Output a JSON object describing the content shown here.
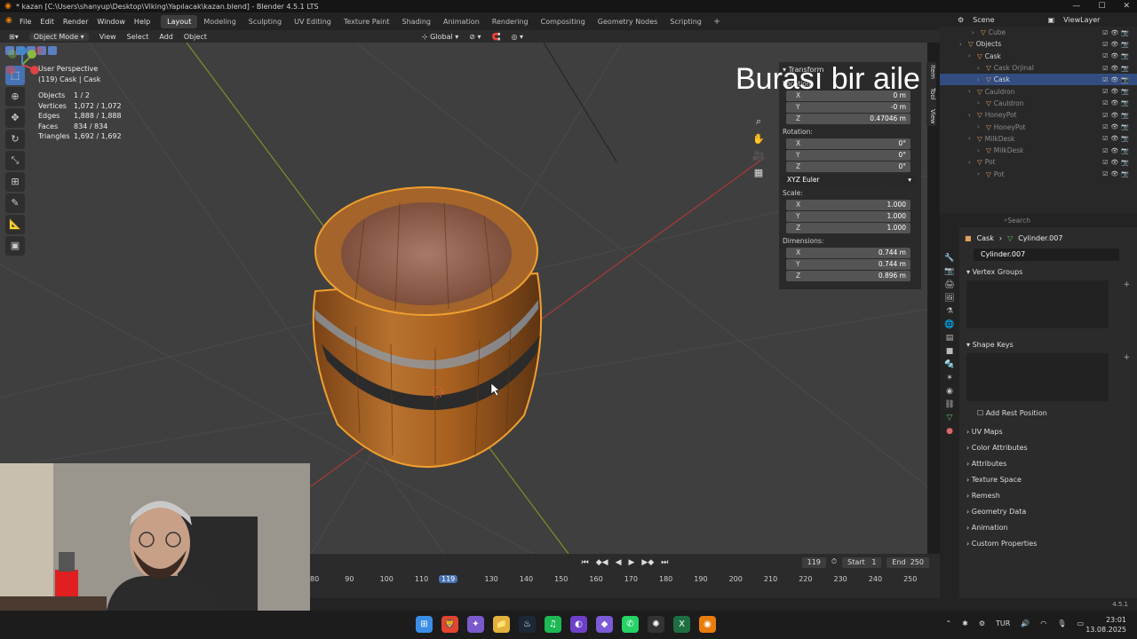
{
  "window": {
    "title": "* kazan [C:\\Users\\shanyup\\Desktop\\Viking\\Yapılacak\\kazan.blend] - Blender 4.5.1 LTS",
    "min": "—",
    "max": "☐",
    "close": "✕"
  },
  "menu": [
    "File",
    "Edit",
    "Render",
    "Window",
    "Help"
  ],
  "workspaces": [
    "Layout",
    "Modeling",
    "Sculpting",
    "UV Editing",
    "Texture Paint",
    "Shading",
    "Animation",
    "Rendering",
    "Compositing",
    "Geometry Nodes",
    "Scripting"
  ],
  "workspace_add": "+",
  "viewport_header": {
    "mode": "Object Mode",
    "items": [
      "View",
      "Select",
      "Add",
      "Object"
    ],
    "orientation": "Global"
  },
  "overlay_stats": {
    "view": "User Perspective",
    "sub": "(119) Cask | Cask",
    "rows": [
      {
        "k": "Objects",
        "v": "1 / 2"
      },
      {
        "k": "Vertices",
        "v": "1,072 / 1,072"
      },
      {
        "k": "Edges",
        "v": "1,888 / 1,888"
      },
      {
        "k": "Faces",
        "v": "834 / 834"
      },
      {
        "k": "Triangles",
        "v": "1,692 / 1,692"
      }
    ]
  },
  "subtitle": "Burası bir aile müessesesi.",
  "npanel": {
    "header": "Transform",
    "location_label": "Location:",
    "location": [
      {
        "ax": "X",
        "v": "0 m"
      },
      {
        "ax": "Y",
        "v": "-0 m"
      },
      {
        "ax": "Z",
        "v": "0.47046 m"
      }
    ],
    "rotation_label": "Rotation:",
    "rotation": [
      {
        "ax": "X",
        "v": "0°"
      },
      {
        "ax": "Y",
        "v": "0°"
      },
      {
        "ax": "Z",
        "v": "0°"
      }
    ],
    "rotation_mode": "XYZ Euler",
    "scale_label": "Scale:",
    "scale": [
      {
        "ax": "X",
        "v": "1.000"
      },
      {
        "ax": "Y",
        "v": "1.000"
      },
      {
        "ax": "Z",
        "v": "1.000"
      }
    ],
    "dimensions_label": "Dimensions:",
    "dimensions": [
      {
        "ax": "X",
        "v": "0.744 m"
      },
      {
        "ax": "Y",
        "v": "0.744 m"
      },
      {
        "ax": "Z",
        "v": "0.896 m"
      }
    ],
    "tabs": [
      "Item",
      "Tool",
      "View"
    ]
  },
  "outliner": {
    "scene": "Scene",
    "view_layer": "ViewLayer",
    "rows": [
      {
        "label": "Cube",
        "indent": 36,
        "cls": "dim"
      },
      {
        "label": "Objects",
        "indent": 22,
        "cls": ""
      },
      {
        "label": "Cask",
        "indent": 32,
        "cls": ""
      },
      {
        "label": "Cask Orjinal",
        "indent": 42,
        "cls": "dim"
      },
      {
        "label": "Cask",
        "indent": 42,
        "cls": "sel"
      },
      {
        "label": "Cauldron",
        "indent": 32,
        "cls": "dim"
      },
      {
        "label": "Cauldron",
        "indent": 42,
        "cls": "dim"
      },
      {
        "label": "HoneyPot",
        "indent": 32,
        "cls": "dim"
      },
      {
        "label": "HoneyPot",
        "indent": 42,
        "cls": "dim"
      },
      {
        "label": "MilkDesk",
        "indent": 32,
        "cls": "dim"
      },
      {
        "label": "MilkDesk",
        "indent": 42,
        "cls": "dim"
      },
      {
        "label": "Pot",
        "indent": 32,
        "cls": "dim"
      },
      {
        "label": "Pot",
        "indent": 42,
        "cls": "dim"
      }
    ]
  },
  "properties": {
    "search_placeholder": "Search",
    "object": "Cask",
    "mesh": "Cylinder.007",
    "sections": {
      "vertex_groups": "Vertex Groups",
      "shape_keys": "Shape Keys",
      "add_rest": "Add Rest Position",
      "rest": [
        "UV Maps",
        "Color Attributes",
        "Attributes",
        "Texture Space",
        "Remesh",
        "Geometry Data",
        "Animation",
        "Custom Properties"
      ]
    }
  },
  "timeline": {
    "current": "119",
    "start_label": "Start",
    "start": "1",
    "end_label": "End",
    "end": "250",
    "ticks": [
      "80",
      "90",
      "100",
      "110",
      "130",
      "140",
      "150",
      "160",
      "170",
      "180",
      "190",
      "200",
      "210",
      "220",
      "230",
      "240",
      "250"
    ]
  },
  "status_version": "4.5.1",
  "taskbar": {
    "lang": "TUR",
    "time": "23:01",
    "date": "13.08.2025"
  }
}
